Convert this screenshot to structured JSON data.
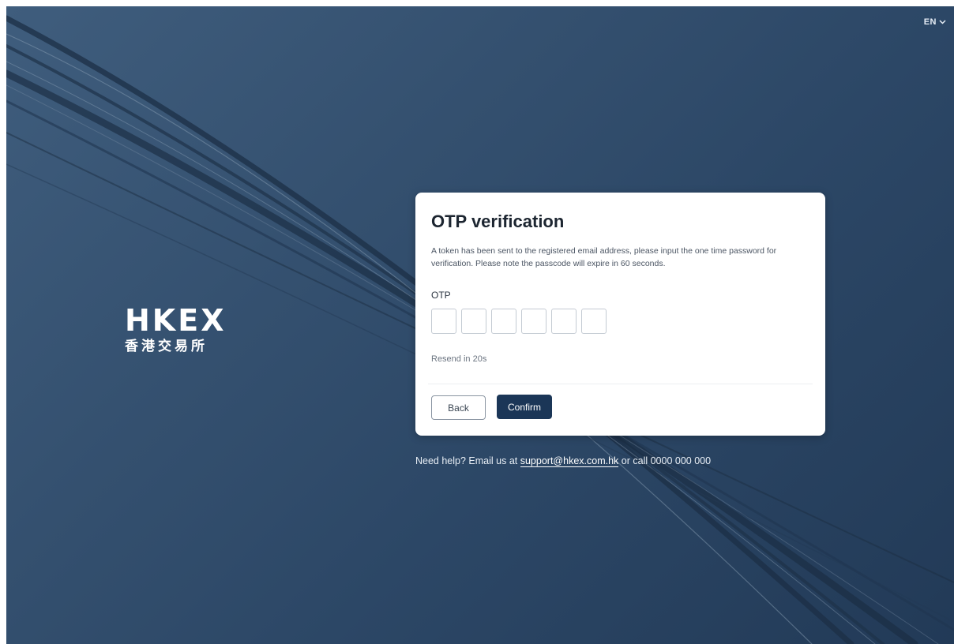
{
  "header": {
    "language": "EN",
    "language_icon": "chevron-down-icon"
  },
  "brand": {
    "name_en": "HKEX",
    "name_zh": "香港交易所"
  },
  "otp_card": {
    "title": "OTP verification",
    "description": "A token has been sent to the registered email address, please input the one time password for verification. Please note the passcode will expire in 60 seconds.",
    "otp_label": "OTP",
    "otp_digits": [
      "",
      "",
      "",
      "",
      "",
      ""
    ],
    "resend_text": "Resend in 20s",
    "back_label": "Back",
    "confirm_label": "Confirm"
  },
  "help": {
    "prefix": "Need help? Email us at",
    "email": "support@hkex.com.hk",
    "suffix": "or call 0000 000 000"
  },
  "colors": {
    "background": "#2f4a69",
    "card": "#ffffff",
    "primary_button": "#1b3657",
    "help_link": "#ffffff"
  }
}
